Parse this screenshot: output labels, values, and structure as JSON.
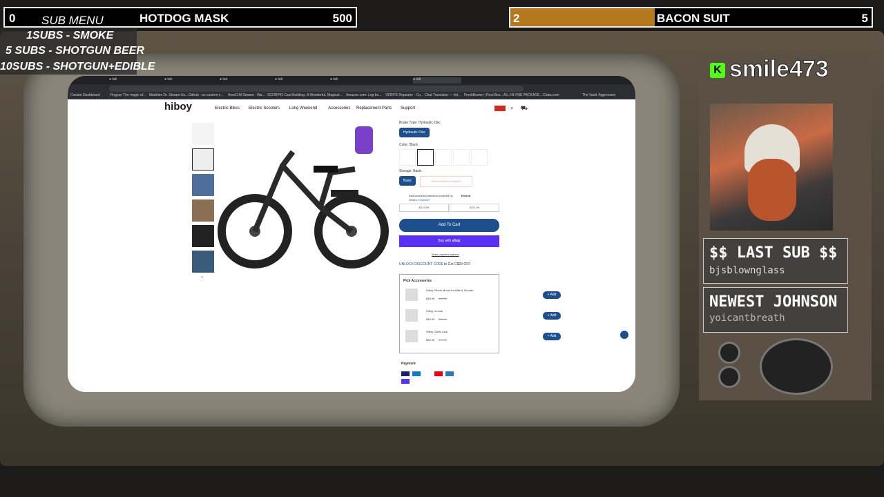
{
  "topbar": {
    "left_count": "0",
    "left_label": "HOTDOG MASK",
    "left_value": "500",
    "right_count": "2",
    "right_label": "BACON SUIT",
    "right_value": "5",
    "right_progress": 0.4
  },
  "submenu": {
    "title": "SUB MENU",
    "items": [
      "1SUBS   - SMOKE",
      "5 SUBS  - SHOTGUN BEER",
      "10SUBS - SHOTGUN+EDIBLE"
    ]
  },
  "streamer": {
    "name": "smile473"
  },
  "last_sub": {
    "title": "$$ LAST SUB $$",
    "name": "bjsblownglass"
  },
  "newest": {
    "title": "NEWEST JOHNSON",
    "name": "yoicantbreath"
  },
  "browser": {
    "bookmarks": [
      "Creator Dashboard",
      "Yingyun The magic of...",
      "Markhim Dr. Stream Us...",
      "Github - ac-custom-s...",
      "AreoCrM Stream - Wa...",
      "SCORPIO Cast Building...",
      "A Wonderful, Magical...",
      "Amazon.com: Log bo...",
      "VERIFE Repeater - Co...",
      "Chat Translator — Ad...",
      "FreshBowen | Real Box...",
      "ALL IN ONE PACKAGE...",
      "Clubs.com",
      "The Vault: Aggressive"
    ]
  },
  "site": {
    "logo": "hiboy",
    "nav": [
      "Electric Bikes",
      "Electric Scooters",
      "Long Weekend",
      "Accessories",
      "Replacement Parts",
      "Support"
    ],
    "brake_type_label": "Brake Type: Hydraulic Disc",
    "brake_option": "Hydraulic Disc",
    "color_label": "Color: Black",
    "storage_label": "Storage: Basic",
    "storage_option": "Basic",
    "storage_option_alt": "Rear Pack/Front Basket",
    "protection_text": "Add accident protection powered by",
    "protection_brand": "Extend",
    "whats_covered": "What's Covered?",
    "plan1": "$229.99",
    "plan2": "$251.99",
    "add_to_cart": "Add To Cart",
    "buy_with": "Buy with",
    "shop_pay": "shop",
    "more_payment": "More payment options",
    "unlock": "UNLOCK DISCOUNT CODE",
    "unlock_tail": "to Get C$20 OFF",
    "pick_accessories": "Pick Accessories",
    "accessories": [
      {
        "name": "Hiboy Phone Mount for Bike & Scooter",
        "price": "$39.99",
        "old": "$49.99",
        "add": "+ Add"
      },
      {
        "name": "Hiboy U-Lock",
        "price": "$49.99",
        "old": "$99.99",
        "add": "+ Add"
      },
      {
        "name": "Hiboy Cable Lock",
        "price": "$30.99",
        "old": "$79.99",
        "add": "+ Add"
      }
    ],
    "payment_label": "Payment"
  }
}
